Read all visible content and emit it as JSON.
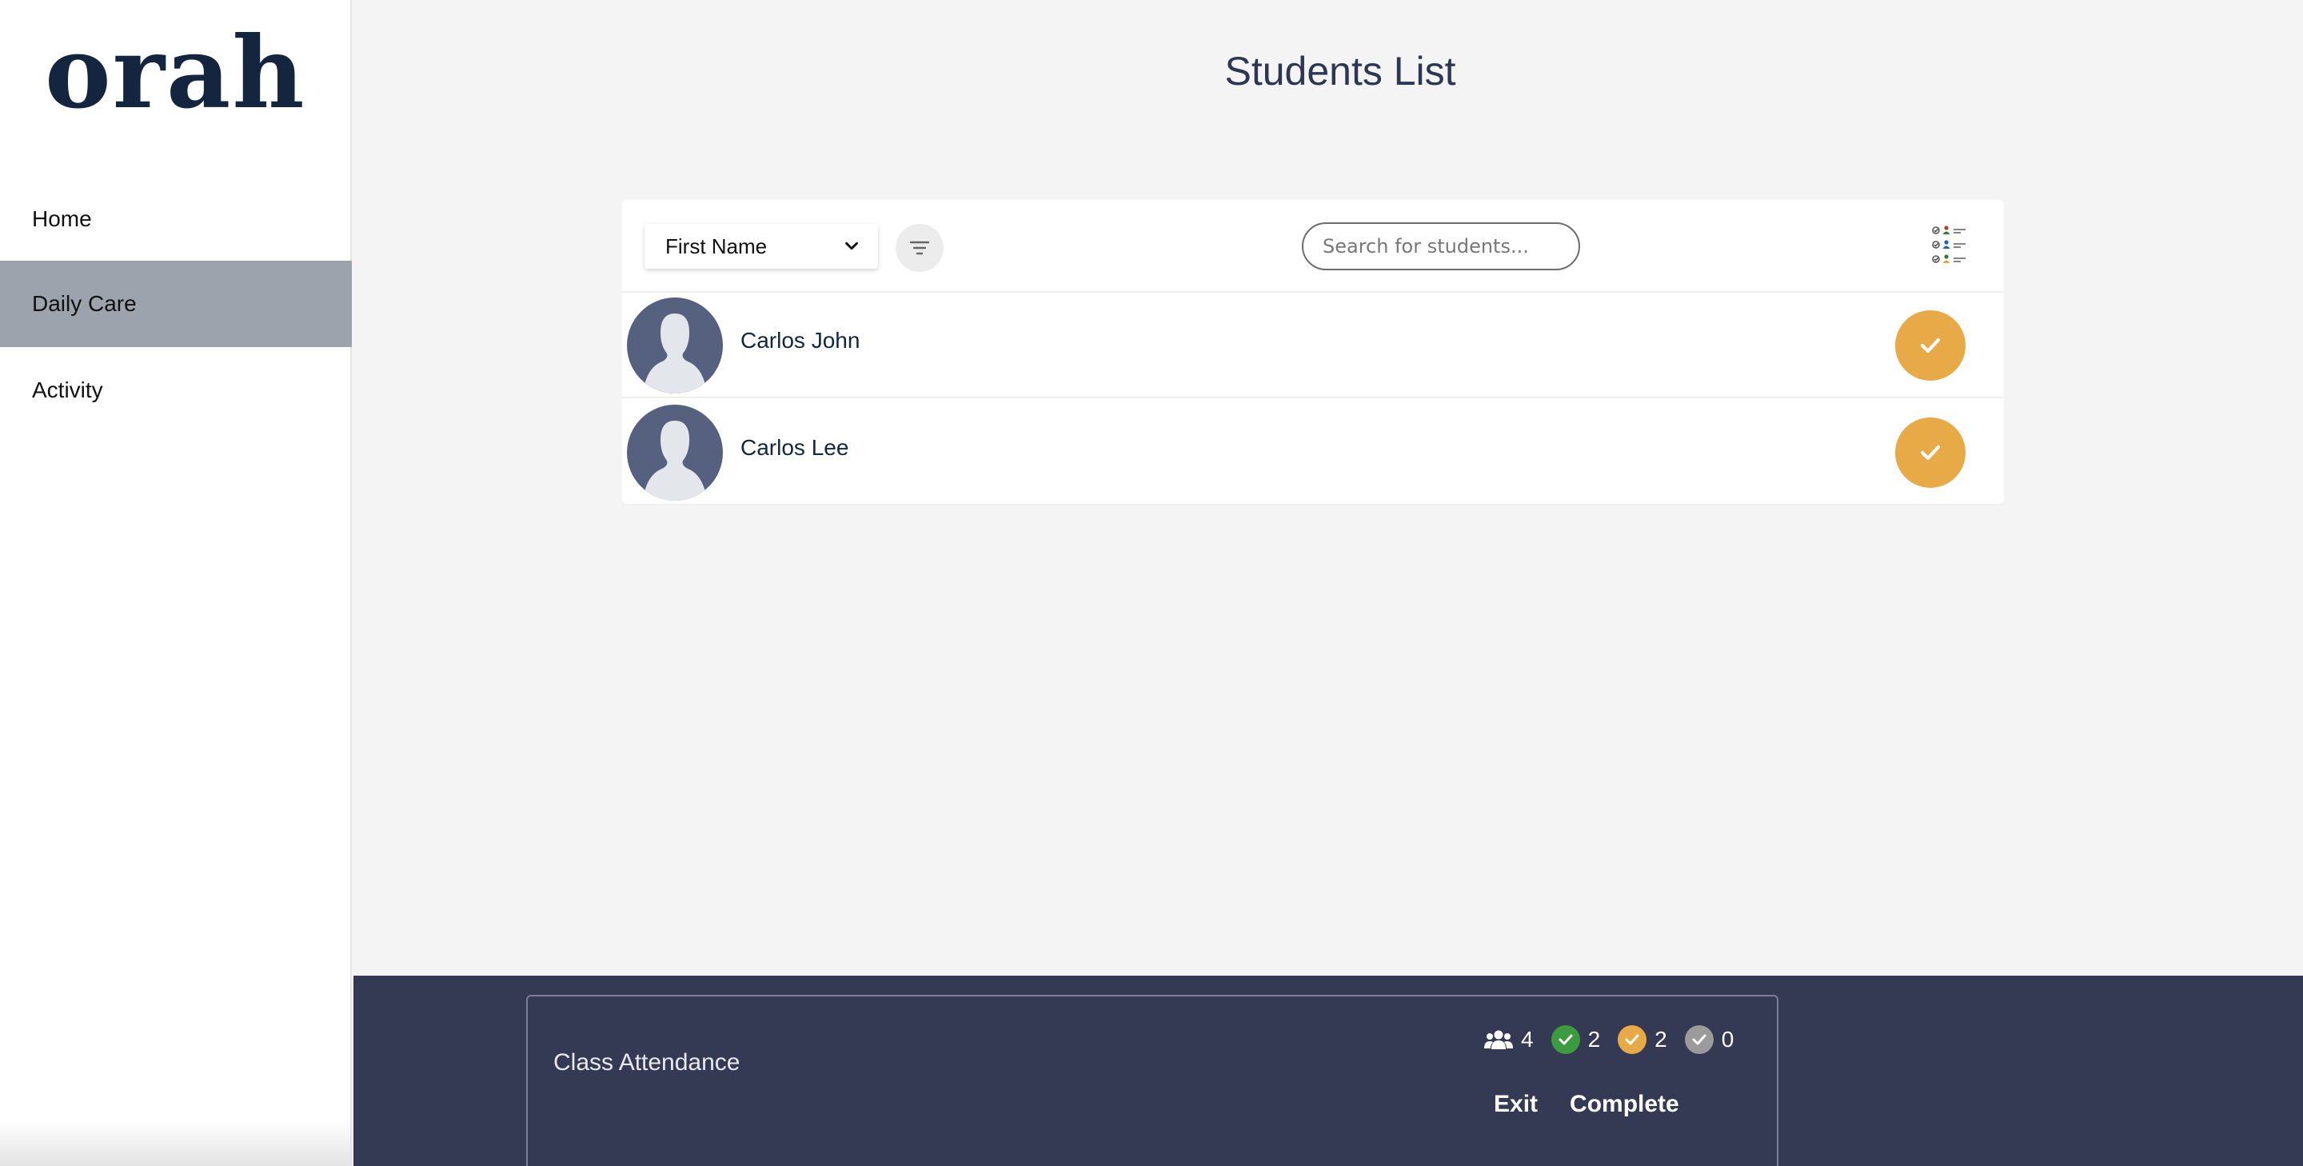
{
  "brand": {
    "logo_text": "orah"
  },
  "sidebar": {
    "items": [
      {
        "label": "Home",
        "active": false
      },
      {
        "label": "Daily Care",
        "active": true
      },
      {
        "label": "Activity",
        "active": false
      }
    ]
  },
  "main": {
    "title": "Students List",
    "toolbar": {
      "sort_field": "First Name",
      "search_placeholder": "Search for students..."
    },
    "students": [
      {
        "name": "Carlos John",
        "status_icon": "check-icon",
        "status_color": "#e8a947"
      },
      {
        "name": "Carlos Lee",
        "status_icon": "check-icon",
        "status_color": "#e8a947"
      }
    ]
  },
  "footer": {
    "title": "Class Attendance",
    "stats": [
      {
        "icon": "users-icon",
        "count": "4"
      },
      {
        "icon": "present-check-icon",
        "color": "#3c9a3f",
        "count": "2"
      },
      {
        "icon": "late-check-icon",
        "color": "#e8a947",
        "count": "2"
      },
      {
        "icon": "absent-check-icon",
        "color": "#9b9b9b",
        "count": "0"
      }
    ],
    "exit_label": "Exit",
    "complete_label": "Complete"
  },
  "colors": {
    "brand": "#13253f",
    "footer_bg": "#343954",
    "active_nav": "#9ca3ad",
    "accent_orange": "#e8a947",
    "present_green": "#3c9a3f"
  }
}
